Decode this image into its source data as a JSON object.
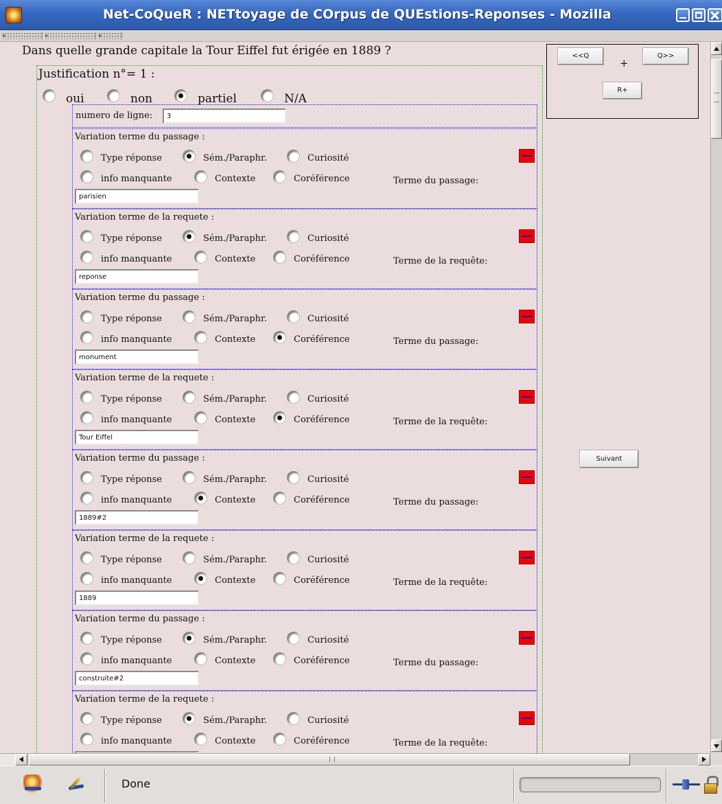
{
  "window": {
    "title": "Net-CoQueR : NETtoyage de COrpus de QUEstions-Reponses - Mozilla"
  },
  "question": "Dans quelle grande capitale la Tour Eiffel fut érigée en 1889 ?",
  "justification": {
    "title": "Justification n°= 1 :",
    "status_options": [
      {
        "label": "oui",
        "checked": false
      },
      {
        "label": "non",
        "checked": false
      },
      {
        "label": "partiel",
        "checked": true
      },
      {
        "label": "N/A",
        "checked": false
      }
    ],
    "line_number_label": "numero de ligne:",
    "line_number_value": "3"
  },
  "option_labels": [
    "Type réponse",
    "Sém./Paraphr.",
    "Curiosité",
    "info manquante",
    "Contexte",
    "Coréférence"
  ],
  "variations": [
    {
      "title": "Variation terme du passage :",
      "term_label": "Terme du passage:",
      "selected": "Sém./Paraphr.",
      "value": "parisien"
    },
    {
      "title": "Variation terme de la requete :",
      "term_label": "Terme de la requête:",
      "selected": "Sém./Paraphr.",
      "value": "reponse"
    },
    {
      "title": "Variation terme du passage :",
      "term_label": "Terme du passage:",
      "selected": "Coréférence",
      "value": "monument"
    },
    {
      "title": "Variation terme de la requete :",
      "term_label": "Terme de la requête:",
      "selected": "Coréférence",
      "value": "Tour Eiffel"
    },
    {
      "title": "Variation terme du passage :",
      "term_label": "Terme du passage:",
      "selected": "Contexte",
      "value": "1889#2"
    },
    {
      "title": "Variation terme de la requete :",
      "term_label": "Terme de la requête:",
      "selected": "Contexte",
      "value": "1889"
    },
    {
      "title": "Variation terme du passage :",
      "term_label": "Terme du passage:",
      "selected": "Sém./Paraphr.",
      "value": "construite#2"
    },
    {
      "title": "Variation terme de la requete :",
      "term_label": "Terme de la requête:",
      "selected": "Sém./Paraphr.",
      "value": ""
    }
  ],
  "nav": {
    "prev_label": "<<Q",
    "plus": "+",
    "next_label": "Q>>",
    "add_label": "R+",
    "suivant_label": "Suivant"
  },
  "status_bar": {
    "text": "Done"
  },
  "colors": {
    "titlebar": "#3668bf",
    "content_bg": "#ebdddd",
    "remove_button": "#f00000",
    "variation_border": "#1a1adb",
    "justification_border": "#2e9a2e"
  }
}
